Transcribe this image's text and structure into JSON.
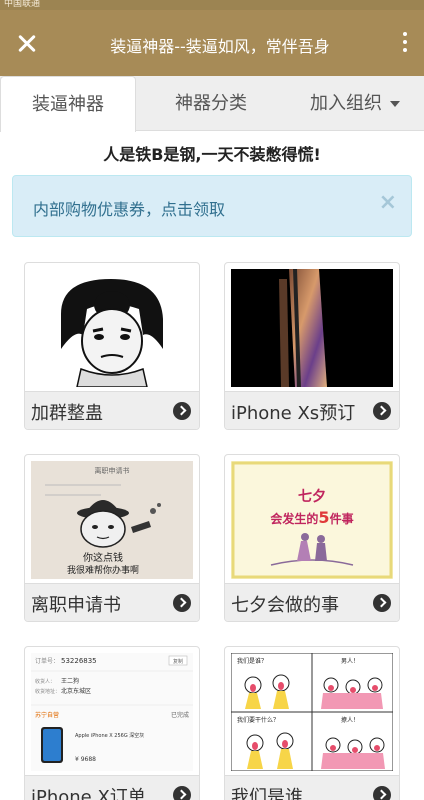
{
  "status_bar": {
    "carrier": "中国联通"
  },
  "header": {
    "title": "装逼神器--装逼如风，常伴吾身"
  },
  "tabs": [
    {
      "label": "装逼神器",
      "active": true
    },
    {
      "label": "神器分类"
    },
    {
      "label": "加入组织"
    }
  ],
  "slogan": "人是铁B是钢,一天不装憋得慌!",
  "alert": {
    "text": "内部购物优惠券，点击领取"
  },
  "cards": [
    {
      "label": "加群整蛊",
      "icon": "meme-face-image"
    },
    {
      "label": "iPhone Xs预订",
      "icon": "iphone-xs-image"
    },
    {
      "label": "离职申请书",
      "icon": "resignation-letter-image",
      "thumb": {
        "title": "离职申请书",
        "line1": "你这点钱",
        "line2": "我很难帮你办事啊"
      }
    },
    {
      "label": "七夕会做的事",
      "icon": "qixi-image",
      "thumb": {
        "title": "七夕",
        "line_prefix": "会发生的",
        "line_num": "5",
        "line_suffix": "件事"
      }
    },
    {
      "label": "iPhone X订单",
      "icon": "order-screenshot-image",
      "thumb": {
        "order_label": "订单号：",
        "order_no": "53226835",
        "copy": "复制",
        "receiver_label": "收货人：",
        "receiver": "王二狗",
        "addr_label": "收货地址：",
        "addr": "北京东城区",
        "store": "苏宁自营",
        "status": "已完成",
        "product": "Apple iPhone X 256G 深空灰",
        "price": "¥ 9688"
      }
    },
    {
      "label": "我们是谁",
      "icon": "comic-panels-image",
      "thumb": {
        "q1": "我们是谁？",
        "a1": "男人！",
        "q2": "我们要干什么？",
        "a2": "撩人！"
      }
    }
  ],
  "colors": {
    "header": "#a78b57",
    "alert_bg": "#d9edf7",
    "alert_text": "#31708f"
  }
}
